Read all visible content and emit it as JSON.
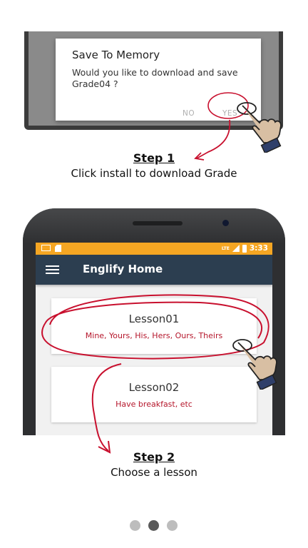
{
  "step1": {
    "dialog": {
      "title": "Save To Memory",
      "message": "Would you like to download and save Grade04 ?",
      "no_label": "NO",
      "yes_label": "YES"
    },
    "title": "Step 1",
    "description": "Click install to download Grade"
  },
  "step2": {
    "status_bar": {
      "network": "LTE",
      "time": "3:33"
    },
    "app_title": "Englify Home",
    "lessons": [
      {
        "title": "Lesson01",
        "subtitle": "Mine, Yours, His, Hers, Ours, Theirs"
      },
      {
        "title": "Lesson02",
        "subtitle": "Have breakfast, etc"
      }
    ],
    "title": "Step 2",
    "description": "Choose a lesson"
  },
  "pager": {
    "count": 3,
    "active_index": 1
  },
  "colors": {
    "status_bar": "#f5a623",
    "app_bar": "#2c3e50",
    "annotation_red": "#c8102e",
    "lesson_subtitle": "#b5162b"
  },
  "icons": [
    "hand-pointer-icon",
    "hamburger-menu-icon",
    "mail-icon",
    "sd-card-icon",
    "signal-icon",
    "battery-icon"
  ]
}
